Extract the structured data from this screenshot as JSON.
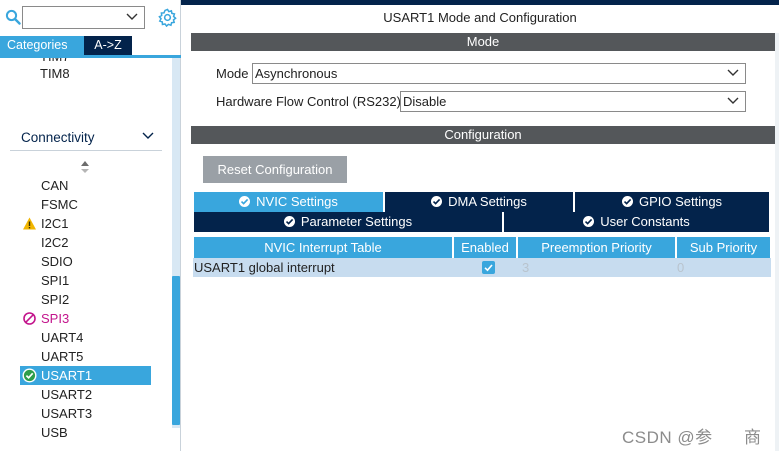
{
  "sidebar": {
    "search": {
      "value": ""
    },
    "tabs": [
      {
        "label": "Categories",
        "active": true
      },
      {
        "label": "A->Z",
        "active": false
      }
    ],
    "prev_item": "TIM8",
    "category": "Connectivity",
    "peripherals": [
      {
        "label": "CAN",
        "status": "none"
      },
      {
        "label": "FSMC",
        "status": "none"
      },
      {
        "label": "I2C1",
        "status": "warning"
      },
      {
        "label": "I2C2",
        "status": "none"
      },
      {
        "label": "SDIO",
        "status": "none"
      },
      {
        "label": "SPI1",
        "status": "none"
      },
      {
        "label": "SPI2",
        "status": "none"
      },
      {
        "label": "SPI3",
        "status": "disabled"
      },
      {
        "label": "UART4",
        "status": "none"
      },
      {
        "label": "UART5",
        "status": "none"
      },
      {
        "label": "USART1",
        "status": "enabled"
      },
      {
        "label": "USART2",
        "status": "none"
      },
      {
        "label": "USART3",
        "status": "none"
      },
      {
        "label": "USB",
        "status": "none"
      }
    ]
  },
  "panel": {
    "title": "USART1 Mode and Configuration",
    "mode_section": "Mode",
    "mode": {
      "label": "Mode",
      "value": "Asynchronous"
    },
    "flow_control": {
      "label": "Hardware Flow Control (RS232)",
      "value": "Disable"
    },
    "config_section": "Configuration",
    "reset_button": "Reset Configuration",
    "config_tabs": {
      "nvic": "NVIC Settings",
      "dma": "DMA Settings",
      "gpio": "GPIO Settings",
      "parameter": "Parameter Settings",
      "user_constants": "User Constants"
    },
    "table": {
      "headers": [
        "NVIC Interrupt Table",
        "Enabled",
        "Preemption Priority",
        "Sub Priority"
      ],
      "rows": [
        {
          "name": "USART1 global interrupt",
          "enabled": true,
          "preemption": "3",
          "sub": "0"
        }
      ]
    }
  },
  "watermark": "CSDN @参      商",
  "colors": {
    "accent": "#39a6dd",
    "navy": "#03234b",
    "section_bar": "#54575a",
    "warning": "#f2b600",
    "disabled": "#c3148c",
    "row_bg": "#c7dcef"
  }
}
